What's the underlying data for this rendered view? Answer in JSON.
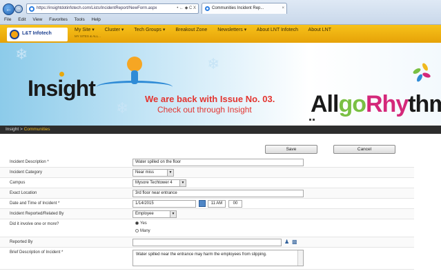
{
  "browser": {
    "address": "https://insightdotinfotech.com/Lists/IncidentReport/NewForm.aspx",
    "address_controls": "• ← ◆ C X",
    "tab_title": "Communities Incident Rep...",
    "tab_close": "×",
    "menu": [
      "File",
      "Edit",
      "View",
      "Favorites",
      "Tools",
      "Help"
    ]
  },
  "site": {
    "logo_text": "L&T Infotech",
    "nav": [
      "My Site ▾",
      "Cluster ▾",
      "Tech Groups ▾",
      "Breakout Zone",
      "Newsletters ▾",
      "About LNT Infotech",
      "About LNT"
    ],
    "nav_sub": "MY SITES & ALL...",
    "brand": "Insight",
    "banner_line1": "We are back with Issue No. 03.",
    "banner_line2": "Check out through Insight",
    "allgo_a": "All",
    "allgo_go": "go",
    "allgo_rhy": "Rhy",
    "allgo_thm": "thm"
  },
  "breadcrumb": {
    "root": "Insight",
    "sep": " > ",
    "current": "Communities"
  },
  "buttons": {
    "save": "Save",
    "cancel": "Cancel"
  },
  "form": {
    "description_label": "Incident Description *",
    "description_value": "Water spilled on the floor",
    "category_label": "Incident Category",
    "category_value": "Near miss",
    "campus_label": "Campus",
    "campus_value": "Mysore Techtower 4",
    "location_label": "Exact Location",
    "location_value": "3rd floor near entrance",
    "datetime_label": "Date and Time of Incident *",
    "date_value": "1/14/2015",
    "hour_value": "11 AM",
    "minute_value": "00",
    "reported_related_label": "Incident Reported/Related By",
    "reported_related_value": "Employee",
    "involve_label": "Did it involve one or more?",
    "involve_options": [
      "Yes",
      "Many"
    ],
    "reported_by_label": "Reported By",
    "reported_by_value": "",
    "brief_label": "Brief Description of Incident *",
    "brief_value": "Water spilled near the entrance may harm the employees from slipping."
  },
  "colors": {
    "nav_bg": "#f0b21a",
    "breadcrumb_bg": "#2d2d2d",
    "banner_text": "#e3342f",
    "accent_orange": "#f0b91e"
  },
  "icons": [
    "back-icon",
    "forward-icon",
    "ie-icon",
    "calendar-icon",
    "people-picker-icon",
    "address-book-icon"
  ]
}
